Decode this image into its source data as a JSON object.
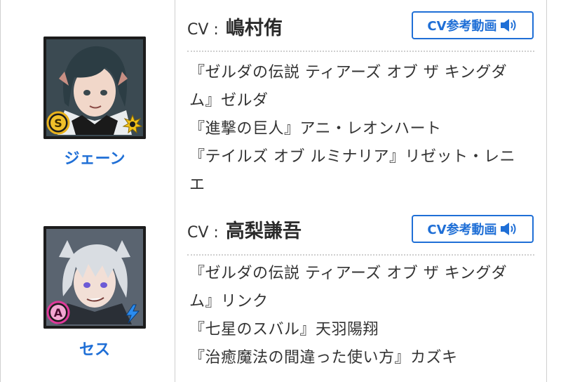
{
  "rows": [
    {
      "character_name": "ジェーン",
      "cv_prefix": "CV :",
      "cv_actor": "嶋村侑",
      "cv_button_label": "CV参考動画",
      "roles": [
        "『ゼルダの伝説 ティアーズ オブ ザ キングダ",
        "ム』ゼルダ",
        "『進撃の巨人』アニ・レオンハート",
        "『テイルズ オブ ルミナリア』リゼット・レニ",
        "エ"
      ],
      "rank_badge": "S",
      "rank_badge_color": "#e8b21c",
      "element_icon": "sun-burst-icon",
      "element_color": "#f2c21a",
      "hair_color": "#2c3d44"
    },
    {
      "character_name": "セス",
      "cv_prefix": "CV :",
      "cv_actor": "高梨謙吾",
      "cv_button_label": "CV参考動画",
      "roles": [
        "『ゼルダの伝説 ティアーズ オブ ザ キングダ",
        "ム』リンク",
        "『七星のスバル』天羽陽翔",
        "『治癒魔法の間違った使い方』カズキ"
      ],
      "rank_badge": "A",
      "rank_badge_color": "#e0399a",
      "element_icon": "lightning-icon",
      "element_color": "#2a8cf0",
      "hair_color": "#d9dde2"
    }
  ],
  "colors": {
    "accent": "#1f6fd6",
    "border": "#cfcfcf",
    "text": "#333333"
  }
}
